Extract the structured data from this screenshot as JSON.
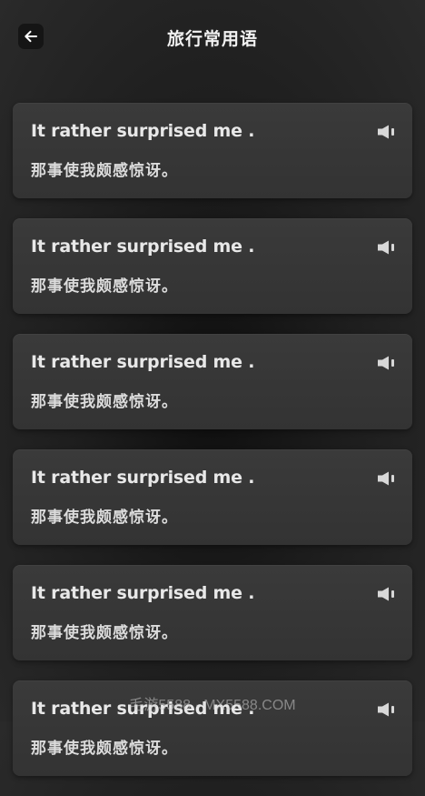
{
  "header": {
    "title": "旅行常用语",
    "back_icon": "arrow-left-icon"
  },
  "phrases": [
    {
      "en": "It rather surprised me .",
      "zh": "那事使我颇感惊讶。",
      "icon": "speaker-icon"
    },
    {
      "en": "It rather surprised me .",
      "zh": "那事使我颇感惊讶。",
      "icon": "speaker-icon"
    },
    {
      "en": "It rather surprised me .",
      "zh": "那事使我颇感惊讶。",
      "icon": "speaker-icon"
    },
    {
      "en": "It rather surprised me .",
      "zh": "那事使我颇感惊讶。",
      "icon": "speaker-icon"
    },
    {
      "en": "It rather surprised me .",
      "zh": "那事使我颇感惊讶。",
      "icon": "speaker-icon"
    },
    {
      "en": "It rather surprised me .",
      "zh": "那事使我颇感惊讶。",
      "icon": "speaker-icon"
    }
  ],
  "watermark": "毛游5588 · MX5588.COM",
  "colors": {
    "background": "#1d1d1d",
    "card": "#363636",
    "text": "#e8e8e8"
  }
}
